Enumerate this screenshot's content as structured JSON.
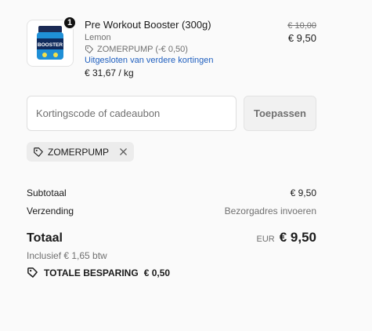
{
  "product": {
    "quantity": "1",
    "name": "Pre Workout Booster (300g)",
    "variant": "Lemon",
    "discount_line": "ZOMERPUMP (-€ 0,50)",
    "excluded_text": "Uitgesloten van verdere kortingen",
    "unit_price": "€ 31,67 / kg",
    "original_price": "€ 10,00",
    "price": "€ 9,50",
    "image_icon": "product-jar-icon",
    "brand_accent": "#1f8fd6"
  },
  "discount": {
    "placeholder": "Kortingscode of cadeaubon",
    "value": "",
    "apply_label": "Toepassen"
  },
  "applied_code": {
    "label": "ZOMERPUMP"
  },
  "summary": {
    "subtotal_label": "Subtotaal",
    "subtotal_value": "€ 9,50",
    "shipping_label": "Verzending",
    "shipping_value": "Bezorgadres invoeren",
    "total_label": "Totaal",
    "currency": "EUR",
    "total_value": "€ 9,50",
    "tax_note": "Inclusief € 1,65 btw",
    "savings_label": "TOTALE BESPARING",
    "savings_value": "€ 0,50"
  },
  "colors": {
    "link": "#1f5fbf",
    "muted": "#707070",
    "background": "#fafafa"
  }
}
